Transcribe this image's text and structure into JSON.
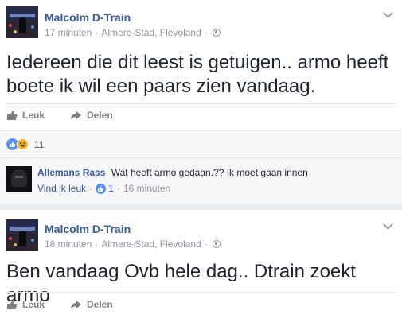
{
  "colors": {
    "link_blue": "#365899",
    "meta_gray": "#90949c",
    "like_blue": "#5890ff",
    "haha_yellow": "#f7b125",
    "page_bg": "#e9ebee"
  },
  "posts": [
    {
      "author": "Malcolm D-Train",
      "time": "17 minuten",
      "location": "Almere-Stad, Flevoland",
      "privacy_icon": "globe-icon",
      "text_line_1": "Iedereen die dit leest is getuigen.. armo heeft",
      "text_line_2": "boete ik wil een paars zien vandaag.",
      "actions": {
        "like": "Leuk",
        "share": "Delen"
      },
      "reactions": {
        "icons": [
          "like-icon",
          "haha-icon"
        ],
        "count": "11"
      },
      "comment": {
        "author": "Allemans Rass",
        "text": "Wat heeft armo gedaan.?? Ik moet gaan innen",
        "like_label": "Vind ik leuk",
        "like_count": "1",
        "time": "16 minuten"
      }
    },
    {
      "author": "Malcolm D-Train",
      "time": "18 minuten",
      "location": "Almere-Stad, Flevoland",
      "privacy_icon": "globe-icon",
      "text_line_1": "Ben vandaag Ovb hele dag.. Dtrain zoekt armo",
      "actions": {
        "like": "Leuk",
        "share": "Delen"
      }
    }
  ]
}
